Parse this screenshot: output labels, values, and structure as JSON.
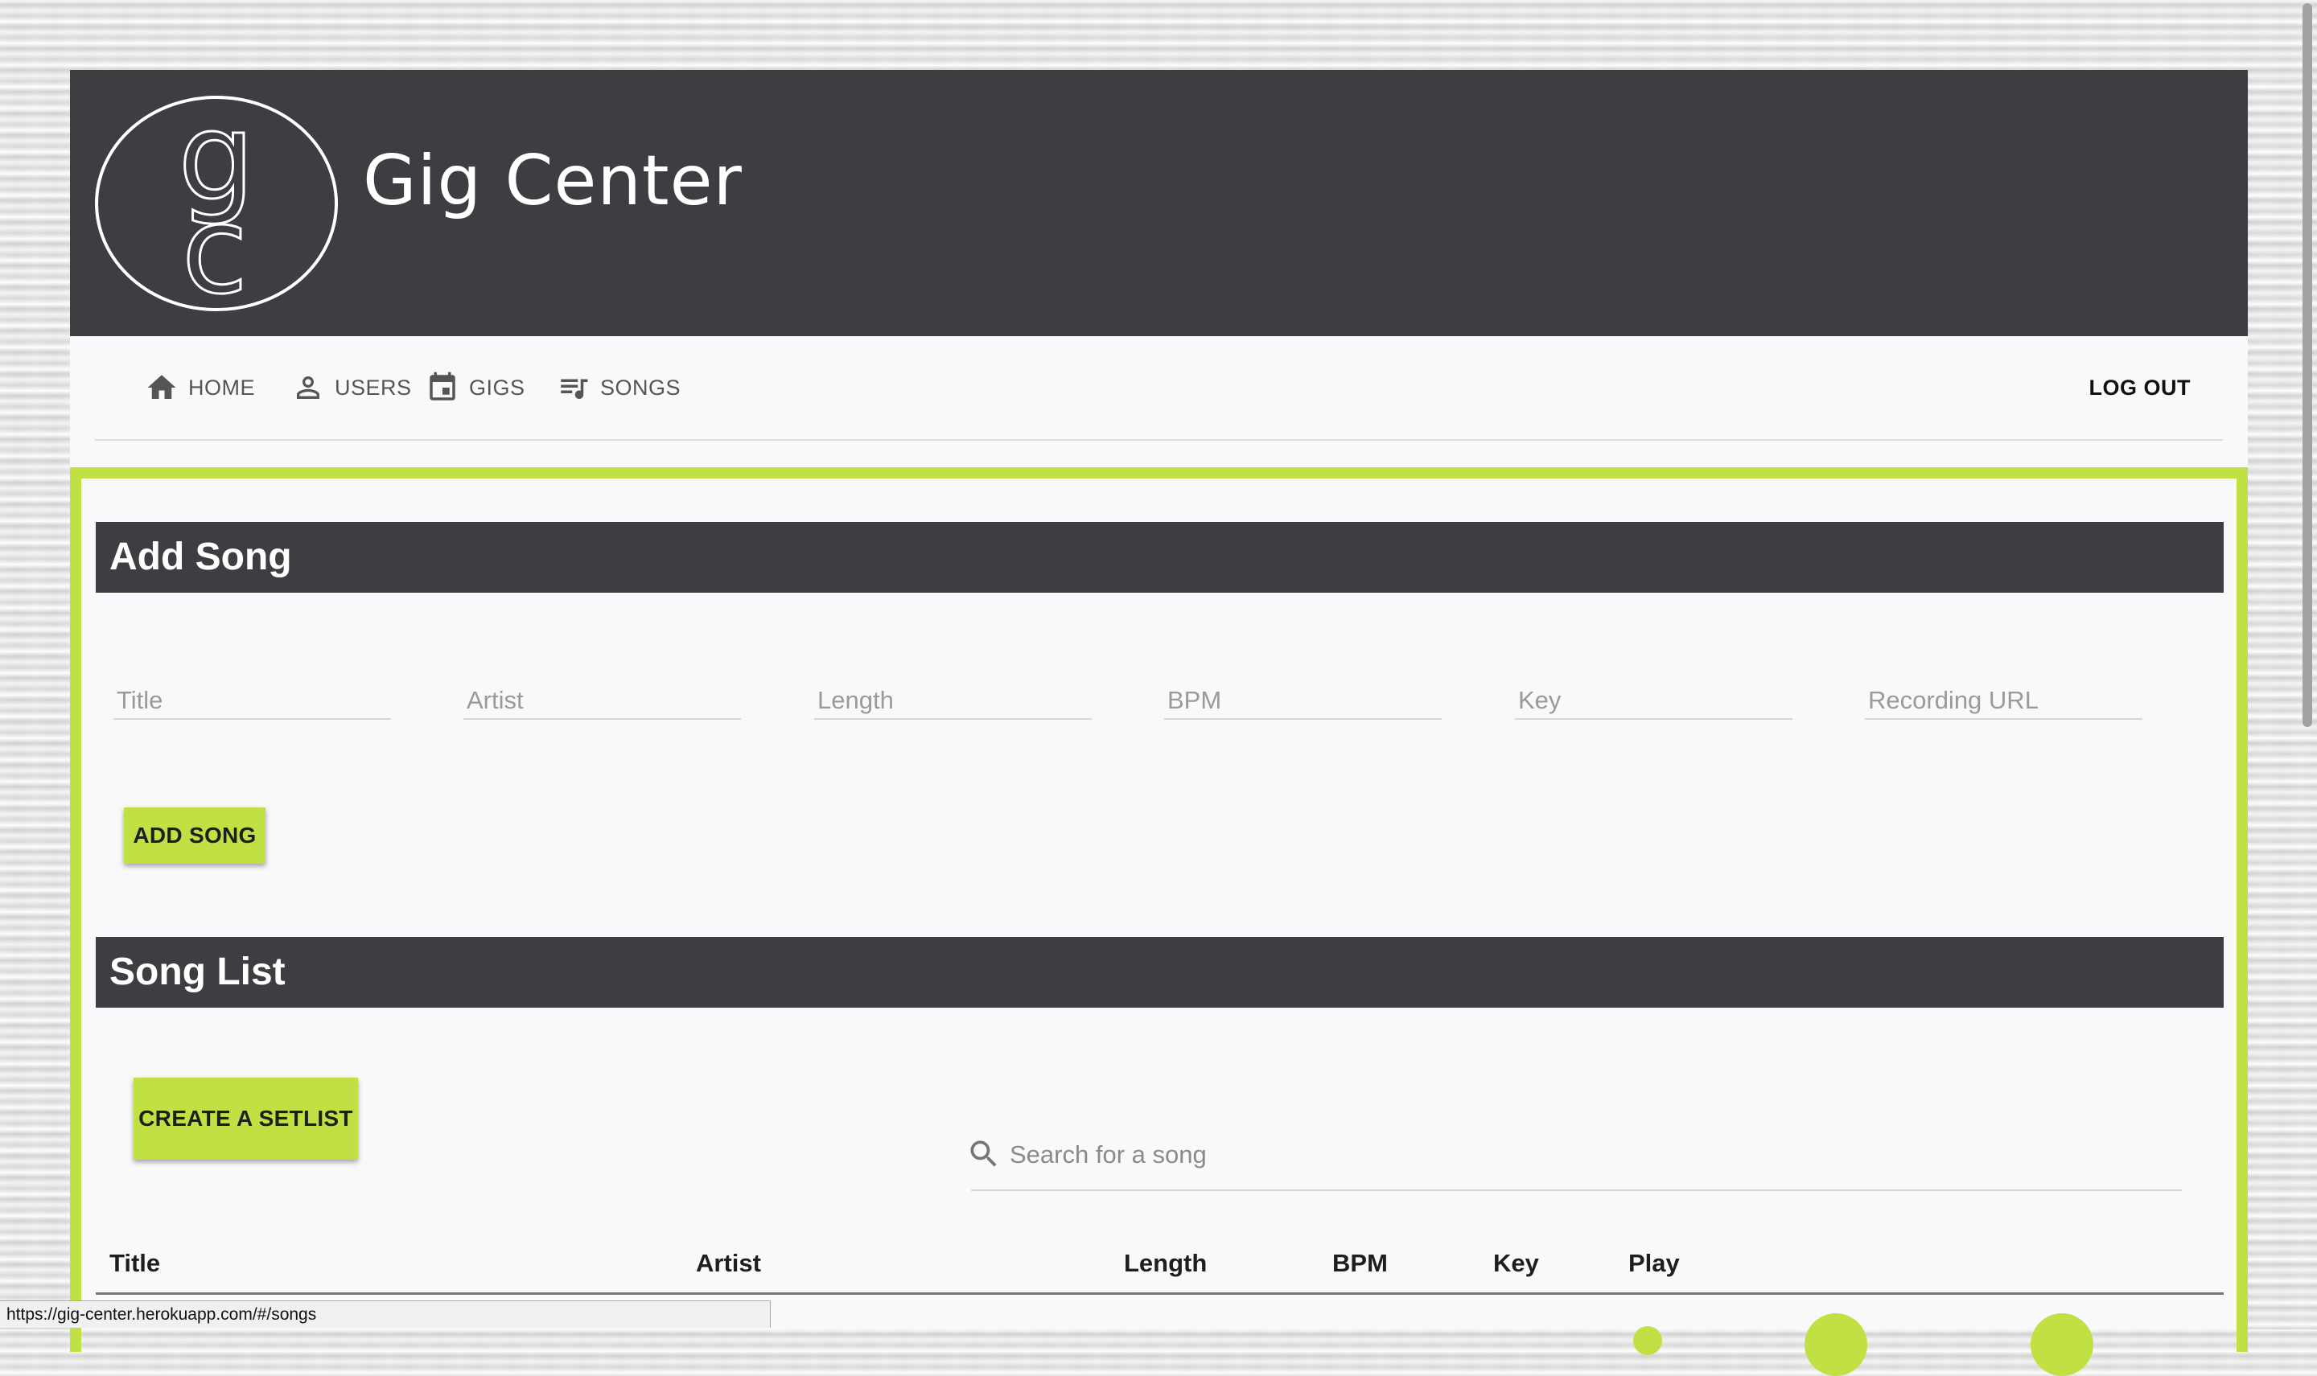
{
  "header": {
    "title": "Gig Center",
    "logo_letters": "gc",
    "background": "#3d3e42"
  },
  "nav": {
    "items": [
      {
        "label": "HOME",
        "icon": "home-icon"
      },
      {
        "label": "USERS",
        "icon": "person-icon"
      },
      {
        "label": "GIGS",
        "icon": "calendar-icon"
      },
      {
        "label": "SONGS",
        "icon": "queue-music-icon"
      }
    ],
    "logout_label": "LOG OUT"
  },
  "add_song": {
    "heading": "Add Song",
    "fields": [
      {
        "placeholder": "Title",
        "value": ""
      },
      {
        "placeholder": "Artist",
        "value": ""
      },
      {
        "placeholder": "Length",
        "value": ""
      },
      {
        "placeholder": "BPM",
        "value": ""
      },
      {
        "placeholder": "Key",
        "value": ""
      },
      {
        "placeholder": "Recording URL",
        "value": ""
      }
    ],
    "button_label": "ADD SONG"
  },
  "song_list": {
    "heading": "Song List",
    "create_setlist_label": "CREATE A SETLIST",
    "search_placeholder": "Search for a song",
    "columns": [
      "Title",
      "Artist",
      "Length",
      "BPM",
      "Key",
      "Play"
    ]
  },
  "status_bar": {
    "url": "https://gig-center.herokuapp.com/#/songs"
  },
  "colors": {
    "accent": "#c1e043",
    "dark": "#3d3e42"
  }
}
